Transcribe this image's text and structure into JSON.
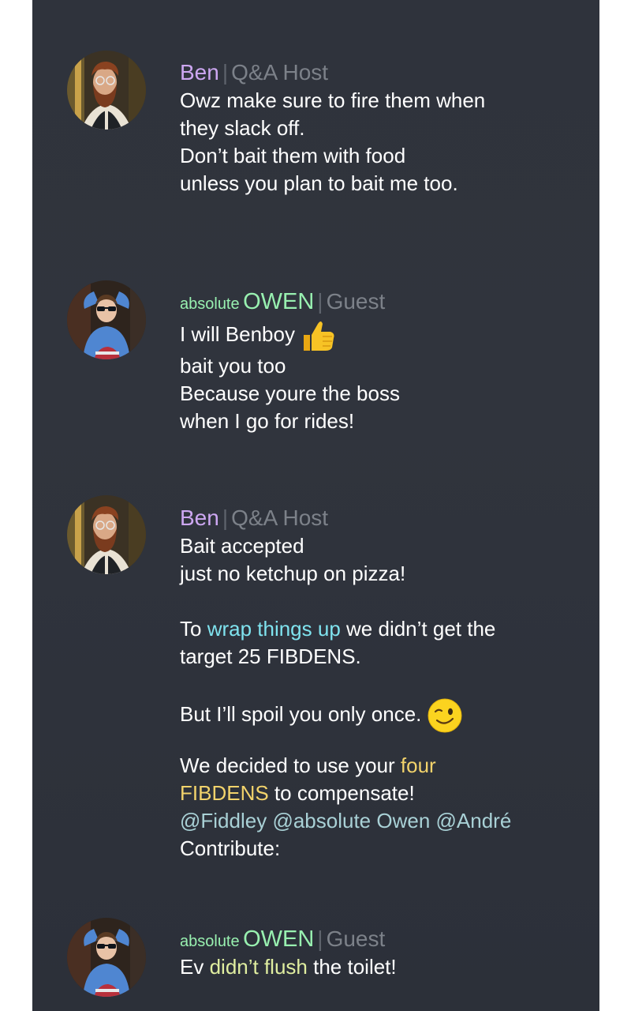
{
  "messages": [
    {
      "author": "Ben",
      "role": "Q&A Host",
      "avatar": "bearded-man-avatar",
      "lines": [
        "Owz make sure to fire them when",
        "they slack off.",
        "Don’t bait them with food",
        "unless you plan to bait me too."
      ]
    },
    {
      "author_prefix": "absolute",
      "author": "OWEN",
      "role": "Guest",
      "avatar": "sunglasses-kid-avatar",
      "line1": "I will Benboy",
      "line1_emoji": "thumbs-up-icon",
      "lines": [
        "bait you too",
        "Because youre the boss",
        "when I go for rides!"
      ]
    },
    {
      "author": "Ben",
      "role": "Q&A Host",
      "avatar": "bearded-man-avatar",
      "l1": "Bait accepted",
      "l2": "just no ketchup on pizza!",
      "l3a": "To ",
      "l3b": "wrap things up",
      "l3c": " we didn’t get the",
      "l4": "target 25 FIBDENS.",
      "l5": "But I’ll spoil you only once.",
      "l5_emoji": "winking-face-icon",
      "l6a": "We decided to use your ",
      "l6b": "four",
      "l7a": "FIBDENS",
      "l7b": " to compensate!",
      "mentions": [
        "@Fiddley",
        "@absolute Owen",
        "@André"
      ],
      "l9": "Contribute:"
    },
    {
      "author_prefix": "absolute",
      "author": "OWEN",
      "role": "Guest",
      "avatar": "sunglasses-kid-avatar",
      "l1a": "Ev ",
      "l1b": "didn’t flush",
      "l1c": " the toilet!"
    }
  ],
  "colors": {
    "background": "#2f333c",
    "host_name": "#cda7f2",
    "guest_name": "#98f0b0",
    "role": "#7c8189",
    "highlight_cyan": "#7fe3ef",
    "highlight_gold": "#f2d36b",
    "mention": "#a9d1d6"
  }
}
